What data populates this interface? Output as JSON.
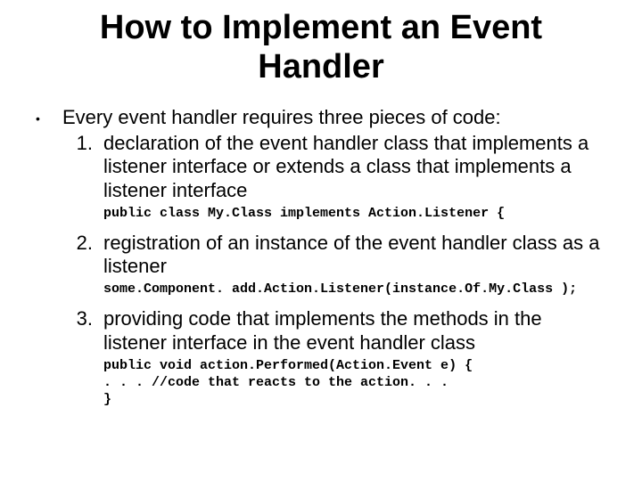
{
  "title": "How to Implement an Event Handler",
  "intro": "Every event handler requires three pieces of code:",
  "items": [
    {
      "num": "1.",
      "text": "declaration of the event handler class that implements a listener interface or extends a class that implements a listener interface",
      "code": "public class My.Class implements Action.Listener {"
    },
    {
      "num": "2.",
      "text": "registration of an instance of the event handler class as a listener",
      "code": "some.Component. add.Action.Listener(instance.Of.My.Class );"
    },
    {
      "num": "3.",
      "text": "providing code that implements the methods in the listener interface in the event handler class",
      "code": "public void action.Performed(Action.Event e) {\n. . . //code that reacts to the action. . .\n}"
    }
  ]
}
